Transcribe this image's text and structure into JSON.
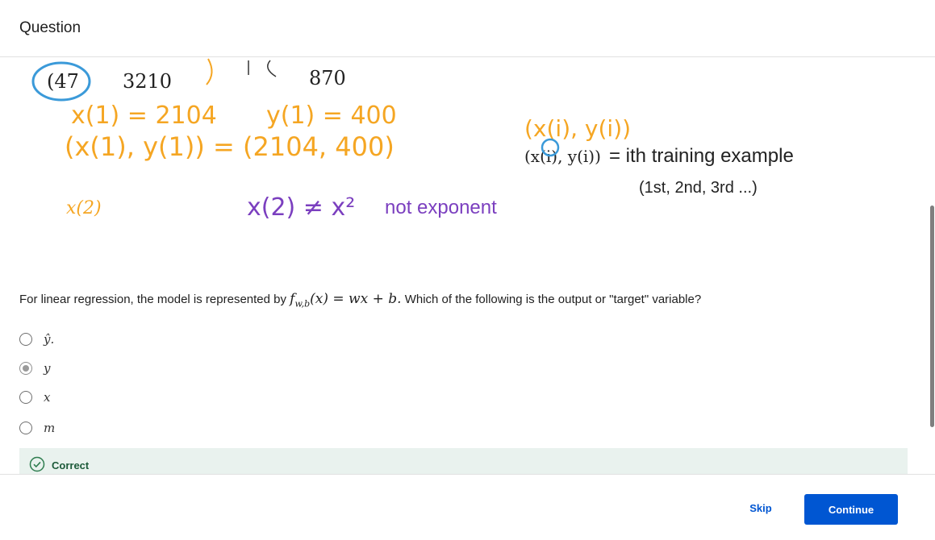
{
  "header": {
    "title": "Question"
  },
  "figure": {
    "hw_47": "(47",
    "hw_3210": "3210",
    "hw_870": "870",
    "hw_x1_eq": "x(1) = 2104",
    "hw_y1_eq": "y(1) = 400",
    "hw_pair_eq": "(x(1), y(1)) = (2104, 400)",
    "hw_pair_i": "(x(i), y(i))",
    "hw_x2": "x(2)",
    "hw_x2_neq": "x(2) ≠ x²",
    "not_exponent": "not exponent",
    "pair_label": "(x(i), y(i))",
    "ith_text": "= ith training example",
    "ordinals": "(1st, 2nd, 3rd ...)"
  },
  "question": {
    "prefix": "For linear regression, the model is represented by",
    "formula_f": "f",
    "formula_sub": "w,b",
    "formula_rest": "(x) = wx + b.",
    "suffix": "Which of the following is the output or \"target\" variable?"
  },
  "options": [
    {
      "label": "ŷ.",
      "selected": false
    },
    {
      "label": "y",
      "selected": true
    },
    {
      "label": "x",
      "selected": false
    },
    {
      "label": "m",
      "selected": false
    }
  ],
  "feedback": {
    "text": "Correct",
    "color": "#1d5b3a"
  },
  "footer": {
    "skip_label": "Skip",
    "continue_label": "Continue"
  },
  "colors": {
    "accent": "#0056d2",
    "handwriting_orange": "#f5a623",
    "handwriting_purple": "#7b3fbf",
    "circle_blue": "#3b9ad9"
  }
}
